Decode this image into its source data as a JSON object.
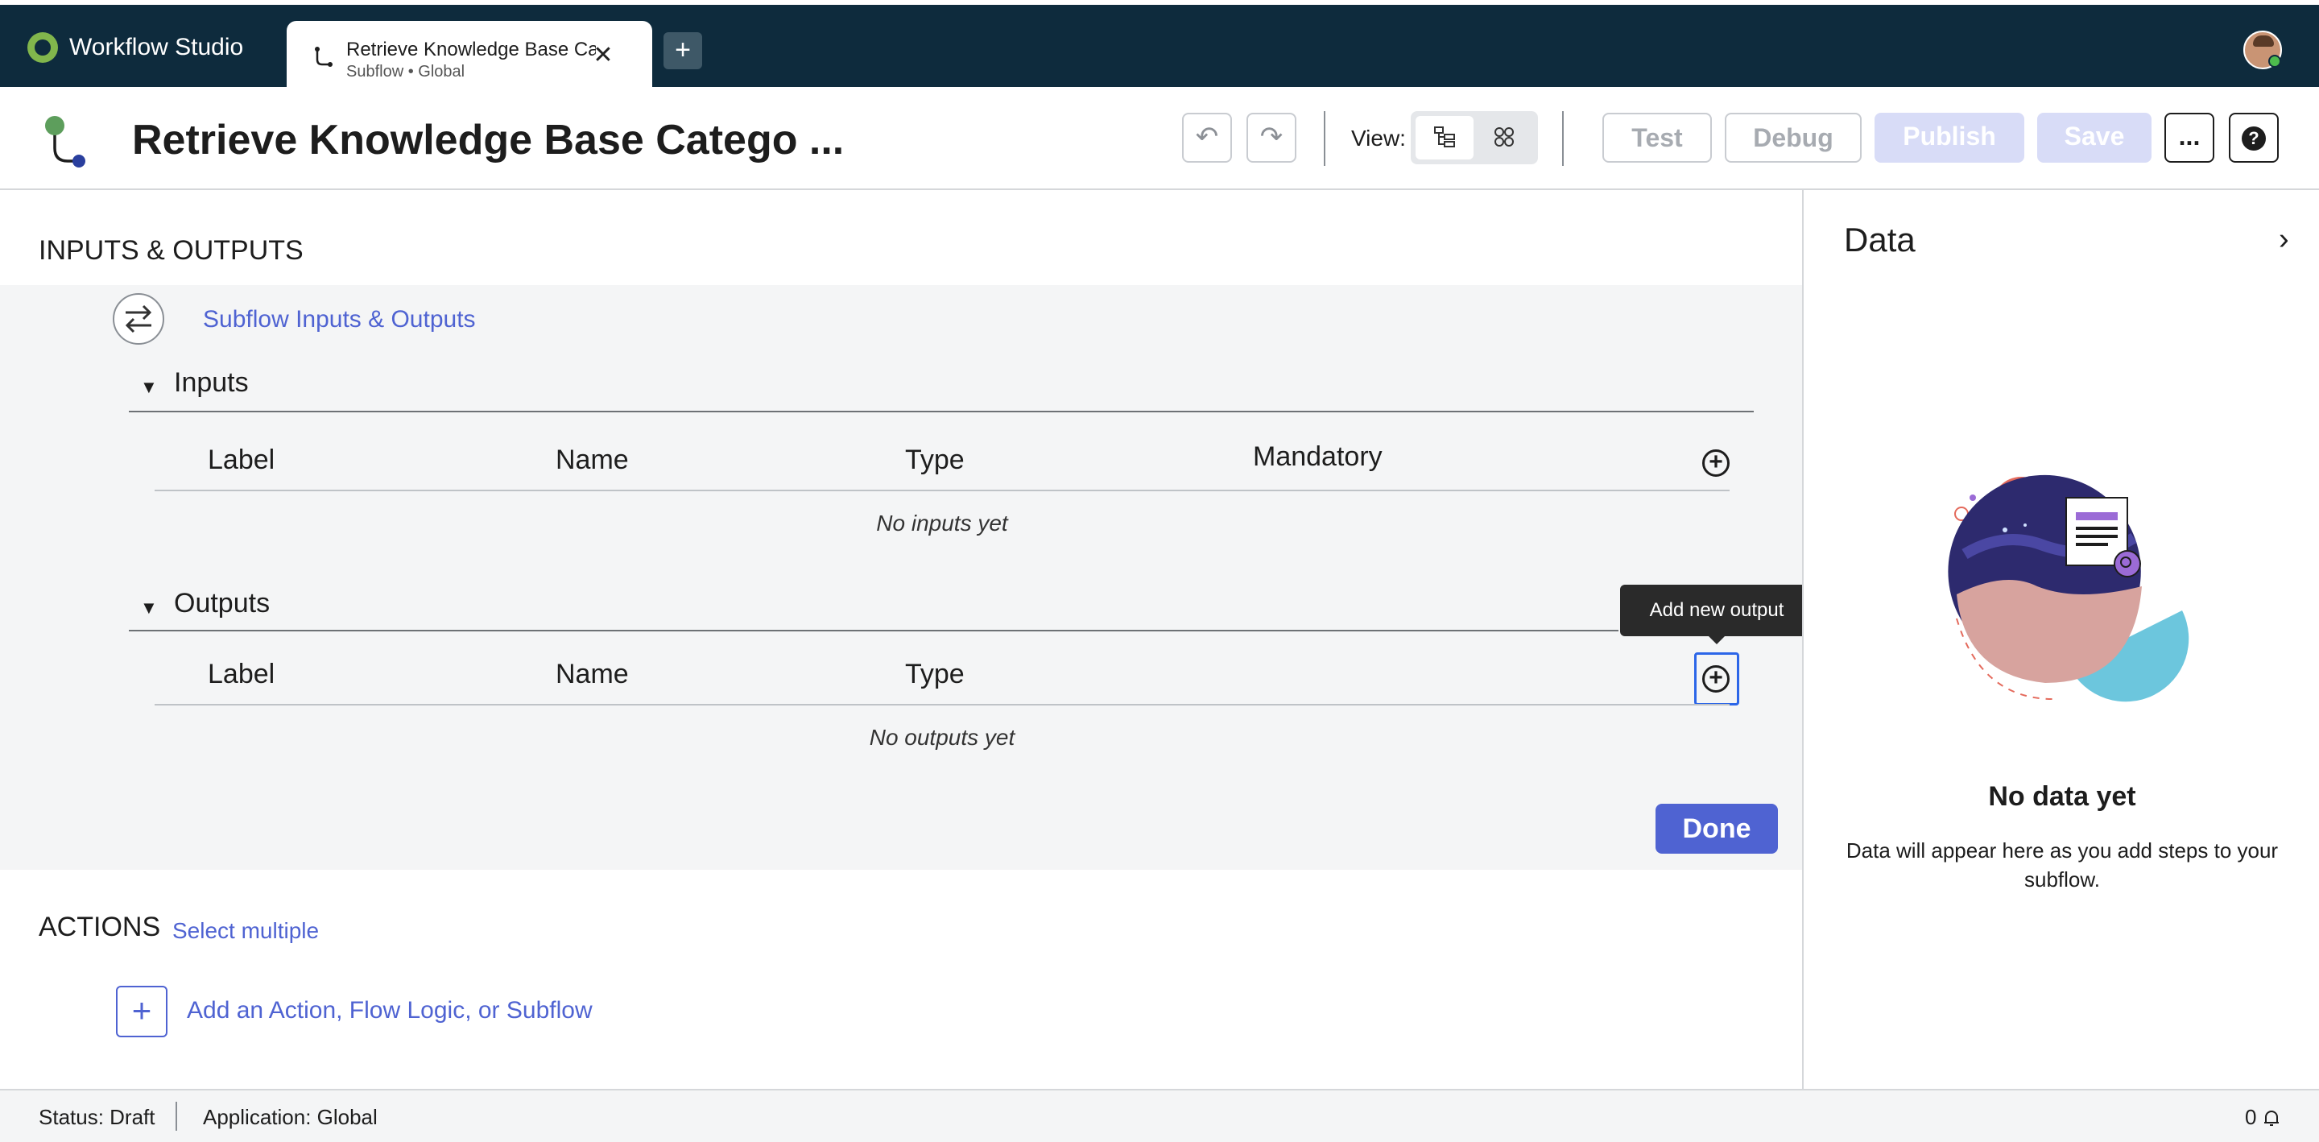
{
  "app": {
    "name": "Workflow Studio"
  },
  "tab": {
    "title": "Retrieve Knowledge Base Ca",
    "subtitle": "Subflow • Global",
    "close_icon": "✕",
    "new_tab_icon": "+"
  },
  "header": {
    "title": "Retrieve Knowledge Base Catego ...",
    "undo_icon": "↶",
    "redo_icon": "↷",
    "view_label": "View:",
    "buttons": {
      "test": "Test",
      "debug": "Debug",
      "publish": "Publish",
      "save": "Save",
      "more": "...",
      "help": "?"
    }
  },
  "main": {
    "io_section_title": "INPUTS & OUTPUTS",
    "io_link": "Subflow Inputs & Outputs",
    "inputs": {
      "title": "Inputs",
      "columns": [
        "Label",
        "Name",
        "Type",
        "Mandatory"
      ],
      "empty": "No inputs yet"
    },
    "outputs": {
      "title": "Outputs",
      "columns": [
        "Label",
        "Name",
        "Type"
      ],
      "empty": "No outputs yet",
      "tooltip": "Add new output"
    },
    "done": "Done",
    "actions_title": "ACTIONS",
    "select_multiple": "Select multiple",
    "add_action_icon": "+",
    "add_action_label": "Add an Action, Flow Logic, or Subflow"
  },
  "data_panel": {
    "title": "Data",
    "chevron": "›",
    "empty_title": "No data yet",
    "empty_text": "Data will appear here as you add steps to your subflow."
  },
  "status": {
    "status": "Status: Draft",
    "application": "Application: Global",
    "notifications": "0"
  },
  "colors": {
    "appbar": "#0e2b3d",
    "accent": "#4f63d2",
    "focus": "#2c66e8"
  }
}
